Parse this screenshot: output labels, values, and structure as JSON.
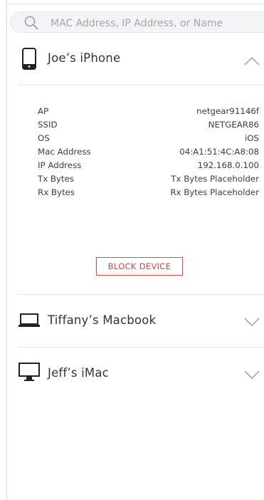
{
  "search": {
    "placeholder": "MAC Address, IP Address, or Name",
    "value": ""
  },
  "devices": [
    {
      "name": "Joe’s iPhone",
      "icon": "phone-icon",
      "expanded": true,
      "details": [
        {
          "label": "AP",
          "value": "netgear91146f"
        },
        {
          "label": "SSID",
          "value": "NETGEAR86"
        },
        {
          "label": "OS",
          "value": "iOS"
        },
        {
          "label": "Mac Address",
          "value": "04:A1:51:4C:A8:08"
        },
        {
          "label": "IP Address",
          "value": "192.168.0.100"
        },
        {
          "label": "Tx Bytes",
          "value": "Tx Bytes Placeholder"
        },
        {
          "label": "Rx Bytes",
          "value": "Rx Bytes Placeholder"
        }
      ],
      "action_label": "BLOCK DEVICE"
    },
    {
      "name": "Tiffany’s Macbook",
      "icon": "laptop-icon",
      "expanded": false
    },
    {
      "name": "Jeff’s iMac",
      "icon": "desktop-icon",
      "expanded": false
    }
  ],
  "colors": {
    "danger": "#e04040",
    "text": "#333333",
    "muted": "#a3a7ad",
    "divider": "#e6e6e6"
  }
}
